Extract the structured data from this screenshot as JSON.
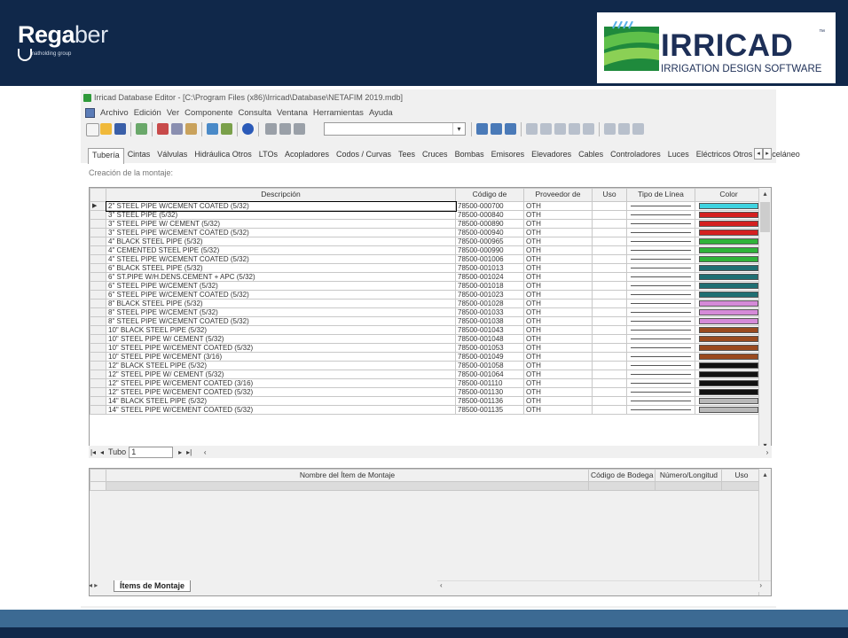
{
  "header": {
    "brand_left_bold": "Rega",
    "brand_left_light": "ber",
    "brand_left_sub": "matholding group",
    "brand_right_name": "IRRICAD",
    "brand_right_tm": "™",
    "brand_right_tagline": "IRRIGATION DESIGN SOFTWARE"
  },
  "window": {
    "title": "Irricad Database Editor - [C:\\Program Files (x86)\\Irricad\\Database\\NETAFIM 2019.mdb]",
    "menu": [
      "Archivo",
      "Edición",
      "Ver",
      "Componente",
      "Consulta",
      "Ventana",
      "Herramientas",
      "Ayuda"
    ],
    "combo_value": ""
  },
  "tabs": [
    "Tubería",
    "Cintas",
    "Válvulas",
    "Hidráulica Otros",
    "LTOs",
    "Acopladores",
    "Codos / Curvas",
    "Tees",
    "Cruces",
    "Bombas",
    "Emisores",
    "Elevadores",
    "Cables",
    "Controladores",
    "Luces",
    "Eléctricos Otros",
    "Misceláneo"
  ],
  "active_tab": "Tubería",
  "section_title": "Creación de la montaje:",
  "grid": {
    "headers": [
      "Descripción",
      "Código de",
      "Proveedor de",
      "Uso",
      "Tipo de Línea",
      "Color"
    ],
    "rows": [
      {
        "desc": "2\" STEEL PIPE W/CEMENT COATED (5/32)",
        "code": "78500-000700",
        "prov": "OTH",
        "uso": "",
        "color": "#3fd3e0"
      },
      {
        "desc": "3\" STEEL PIPE (5/32)",
        "code": "78500-000840",
        "prov": "OTH",
        "uso": "",
        "color": "#d42020"
      },
      {
        "desc": "3\" STEEL PIPE W/ CEMENT (5/32)",
        "code": "78500-000890",
        "prov": "OTH",
        "uso": "",
        "color": "#d42020"
      },
      {
        "desc": "3\" STEEL PIPE W/CEMENT COATED (5/32)",
        "code": "78500-000940",
        "prov": "OTH",
        "uso": "",
        "color": "#d42020"
      },
      {
        "desc": "4\" BLACK STEEL PIPE (5/32)",
        "code": "78500-000965",
        "prov": "OTH",
        "uso": "",
        "color": "#2fb33a"
      },
      {
        "desc": "4\" CEMENTED STEEL PIPE (5/32)",
        "code": "78500-000990",
        "prov": "OTH",
        "uso": "",
        "color": "#2fb33a"
      },
      {
        "desc": "4\" STEEL PIPE W/CEMENT COATED (5/32)",
        "code": "78500-001006",
        "prov": "OTH",
        "uso": "",
        "color": "#2fb33a"
      },
      {
        "desc": "6\" BLACK STEEL PIPE (5/32)",
        "code": "78500-001013",
        "prov": "OTH",
        "uso": "",
        "color": "#1f6f73"
      },
      {
        "desc": "6\" ST.PIPE W/H.DENS.CEMENT + APC (5/32)",
        "code": "78500-001024",
        "prov": "OTH",
        "uso": "",
        "color": "#1f6f73"
      },
      {
        "desc": "6\" STEEL PIPE W/CEMENT (5/32)",
        "code": "78500-001018",
        "prov": "OTH",
        "uso": "",
        "color": "#1f6f73"
      },
      {
        "desc": "6\" STEEL PIPE W/CEMENT COATED (5/32)",
        "code": "78500-001023",
        "prov": "OTH",
        "uso": "",
        "color": "#1f6f73"
      },
      {
        "desc": "8\" BLACK STEEL PIPE (5/32)",
        "code": "78500-001028",
        "prov": "OTH",
        "uso": "",
        "color": "#d58ad8"
      },
      {
        "desc": "8\" STEEL PIPE W/CEMENT (5/32)",
        "code": "78500-001033",
        "prov": "OTH",
        "uso": "",
        "color": "#d58ad8"
      },
      {
        "desc": "8\" STEEL PIPE W/CEMENT COATED (5/32)",
        "code": "78500-001038",
        "prov": "OTH",
        "uso": "",
        "color": "#d58ad8"
      },
      {
        "desc": "10\" BLACK STEEL PIPE (5/32)",
        "code": "78500-001043",
        "prov": "OTH",
        "uso": "",
        "color": "#9a4a1f"
      },
      {
        "desc": "10\" STEEL PIPE W/ CEMENT (5/32)",
        "code": "78500-001048",
        "prov": "OTH",
        "uso": "",
        "color": "#9a4a1f"
      },
      {
        "desc": "10\" STEEL PIPE W/CEMENT COATED (5/32)",
        "code": "78500-001053",
        "prov": "OTH",
        "uso": "",
        "color": "#9a4a1f"
      },
      {
        "desc": "10\" STEEL PIPE W/CEMENT (3/16)",
        "code": "78500-001049",
        "prov": "OTH",
        "uso": "",
        "color": "#9a4a1f"
      },
      {
        "desc": "12\" BLACK STEEL PIPE (5/32)",
        "code": "78500-001058",
        "prov": "OTH",
        "uso": "",
        "color": "#111111"
      },
      {
        "desc": "12\" STEEL PIPE W/ CEMENT (5/32)",
        "code": "78500-001064",
        "prov": "OTH",
        "uso": "",
        "color": "#111111"
      },
      {
        "desc": "12\" STEEL PIPE W/CEMENT COATED (3/16)",
        "code": "78500-001110",
        "prov": "OTH",
        "uso": "",
        "color": "#111111"
      },
      {
        "desc": "12\" STEEL PIPE W/CEMENT COATED (5/32)",
        "code": "78500-001130",
        "prov": "OTH",
        "uso": "",
        "color": "#111111"
      },
      {
        "desc": "14\" BLACK STEEL PIPE (5/32)",
        "code": "78500-001136",
        "prov": "OTH",
        "uso": "",
        "color": "#b8b8b8"
      },
      {
        "desc": "14\" STEEL PIPE W/CEMENT COATED (5/32)",
        "code": "78500-001135",
        "prov": "OTH",
        "uso": "",
        "color": "#b8b8b8"
      }
    ]
  },
  "navbar": {
    "table_name": "Tubo",
    "record": "1"
  },
  "grid2": {
    "headers": [
      "Nombre del Ítem de Montaje",
      "Código de Bodega",
      "Número/Longitud",
      "Uso"
    ]
  },
  "bottom_tab": "Ítems de Montaje",
  "colors": {
    "navy": "#10284a",
    "stripe": "#3c6a93"
  }
}
